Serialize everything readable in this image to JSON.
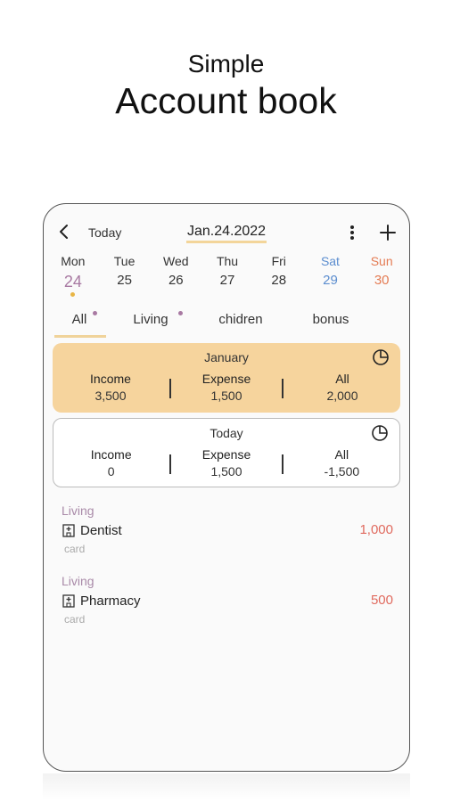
{
  "hero": {
    "subtitle": "Simple",
    "title": "Account book"
  },
  "header": {
    "today_label": "Today",
    "date": "Jan.24.2022"
  },
  "week": [
    {
      "name": "Mon",
      "num": "24"
    },
    {
      "name": "Tue",
      "num": "25"
    },
    {
      "name": "Wed",
      "num": "26"
    },
    {
      "name": "Thu",
      "num": "27"
    },
    {
      "name": "Fri",
      "num": "28"
    },
    {
      "name": "Sat",
      "num": "29"
    },
    {
      "name": "Sun",
      "num": "30"
    }
  ],
  "tabs": [
    {
      "label": "All"
    },
    {
      "label": "Living"
    },
    {
      "label": "chidren"
    },
    {
      "label": "bonus"
    }
  ],
  "month_summary": {
    "title": "January",
    "income_label": "Income",
    "income": "3,500",
    "expense_label": "Expense",
    "expense": "1,500",
    "all_label": "All",
    "all": "2,000"
  },
  "today_summary": {
    "title": "Today",
    "income_label": "Income",
    "income": "0",
    "expense_label": "Expense",
    "expense": "1,500",
    "all_label": "All",
    "all": "-1,500"
  },
  "entries": [
    {
      "category": "Living",
      "name": "Dentist",
      "amount": "1,000",
      "method": "card",
      "icon": "hospital-icon"
    },
    {
      "category": "Living",
      "name": "Pharmacy",
      "amount": "500",
      "method": "card",
      "icon": "hospital-icon"
    }
  ],
  "colors": {
    "accent_yellow": "#f6d49d",
    "selected_purple": "#a879a2",
    "saturday_blue": "#5b8dcf",
    "sunday_orange": "#e47b53",
    "expense_red": "#e06a5e"
  }
}
